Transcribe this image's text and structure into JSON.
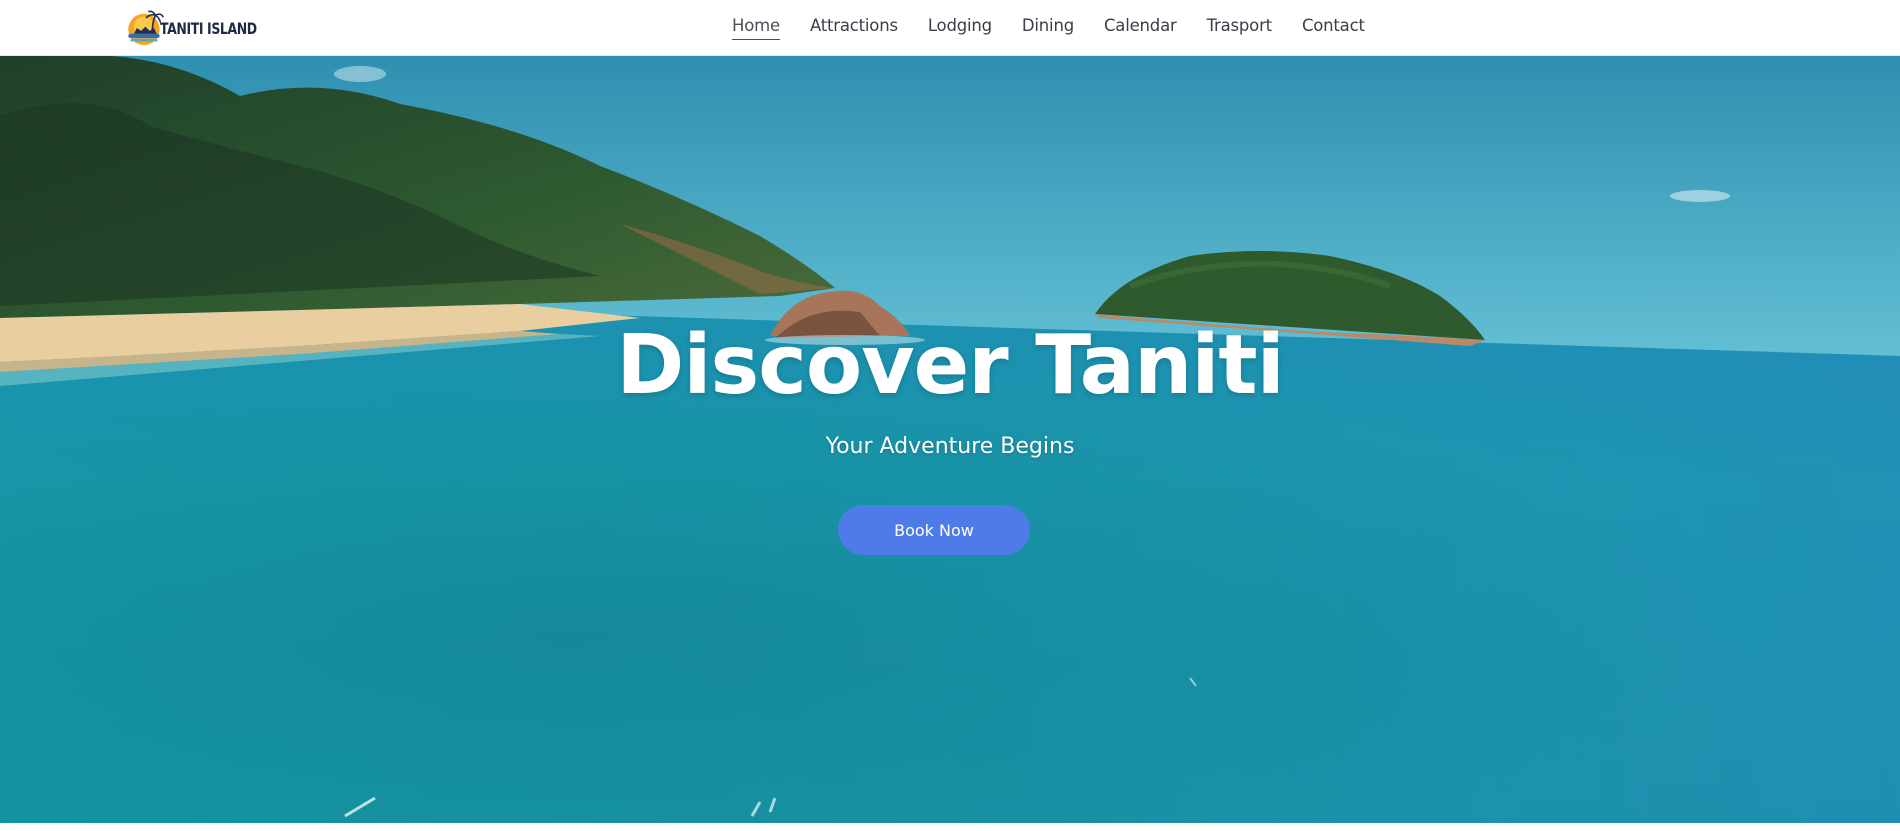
{
  "brand": {
    "name": "TANITI ISLAND",
    "icon": "palm-sunset-logo-icon"
  },
  "nav": {
    "items": [
      {
        "label": "Home",
        "active": true
      },
      {
        "label": "Attractions",
        "active": false
      },
      {
        "label": "Lodging",
        "active": false
      },
      {
        "label": "Dining",
        "active": false
      },
      {
        "label": "Calendar",
        "active": false
      },
      {
        "label": "Trasport",
        "active": false
      },
      {
        "label": "Contact",
        "active": false
      }
    ]
  },
  "hero": {
    "title": "Discover Taniti",
    "subtitle": "Your Adventure Begins",
    "cta_label": "Book Now",
    "background": "tropical-bay-aerial-image"
  },
  "colors": {
    "nav_text": "#3a3f47",
    "button": "#4f7be8",
    "sea": "#1a9aae",
    "sky": "#4fb0c8"
  }
}
